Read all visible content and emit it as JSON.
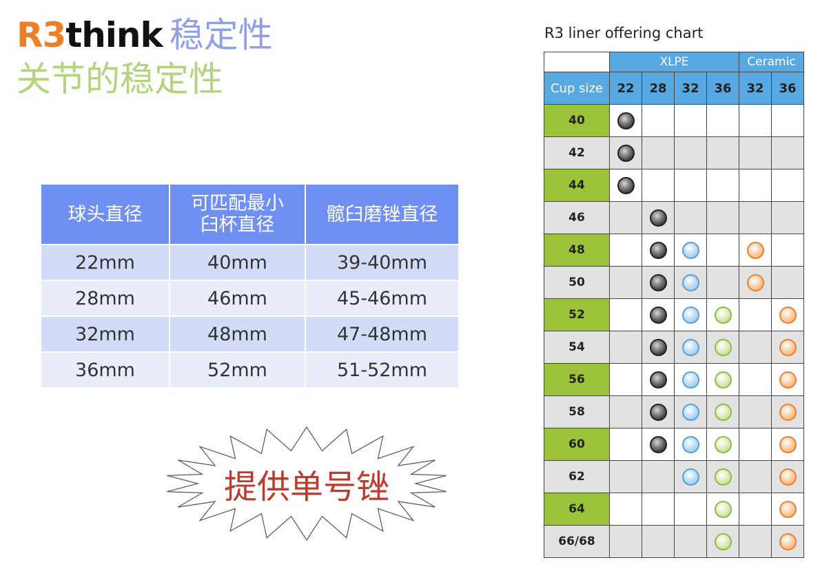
{
  "header": {
    "brand_r3": "R3",
    "brand_think": "think",
    "title_zh": "稳定性",
    "subtitle": "关节的稳定性"
  },
  "left_table": {
    "headers": [
      "球头直径",
      "可匹配最小\n臼杯直径",
      "髋臼磨锉直径"
    ],
    "rows": [
      [
        "22mm",
        "40mm",
        "39-40mm"
      ],
      [
        "28mm",
        "46mm",
        "45-46mm"
      ],
      [
        "32mm",
        "48mm",
        "47-48mm"
      ],
      [
        "36mm",
        "52mm",
        "51-52mm"
      ]
    ]
  },
  "callout": {
    "text": "提供单号锉"
  },
  "chart": {
    "title": "R3 liner offering chart",
    "groups": [
      {
        "label": "XLPE"
      },
      {
        "label": "Ceramic"
      }
    ],
    "cup_size_label": "Cup size",
    "head_sizes": [
      "22",
      "28",
      "32",
      "36",
      "32",
      "36"
    ],
    "rows": [
      {
        "cup": "40",
        "cells": [
          "gray",
          "",
          "",
          "",
          "",
          ""
        ]
      },
      {
        "cup": "42",
        "cells": [
          "gray",
          "",
          "",
          "",
          "",
          ""
        ]
      },
      {
        "cup": "44",
        "cells": [
          "gray",
          "",
          "",
          "",
          "",
          ""
        ]
      },
      {
        "cup": "46",
        "cells": [
          "",
          "gray",
          "",
          "",
          "",
          ""
        ]
      },
      {
        "cup": "48",
        "cells": [
          "",
          "gray",
          "blue",
          "",
          "orange",
          ""
        ]
      },
      {
        "cup": "50",
        "cells": [
          "",
          "gray",
          "blue",
          "",
          "orange",
          ""
        ]
      },
      {
        "cup": "52",
        "cells": [
          "",
          "gray",
          "blue",
          "green",
          "",
          "orange"
        ]
      },
      {
        "cup": "54",
        "cells": [
          "",
          "gray",
          "blue",
          "green",
          "",
          "orange"
        ]
      },
      {
        "cup": "56",
        "cells": [
          "",
          "gray",
          "blue",
          "green",
          "",
          "orange"
        ]
      },
      {
        "cup": "58",
        "cells": [
          "",
          "gray",
          "blue",
          "green",
          "",
          "orange"
        ]
      },
      {
        "cup": "60",
        "cells": [
          "",
          "gray",
          "blue",
          "green",
          "",
          "orange"
        ]
      },
      {
        "cup": "62",
        "cells": [
          "",
          "",
          "blue",
          "green",
          "",
          "orange"
        ]
      },
      {
        "cup": "64",
        "cells": [
          "",
          "",
          "",
          "green",
          "",
          "orange"
        ]
      },
      {
        "cup": "66/68",
        "cells": [
          "",
          "",
          "",
          "green",
          "",
          "orange"
        ]
      }
    ],
    "colors": {
      "header_blue": "#58a8e2",
      "cup_green": "#9dc33b",
      "row_gray": "#e2e2e2"
    }
  }
}
